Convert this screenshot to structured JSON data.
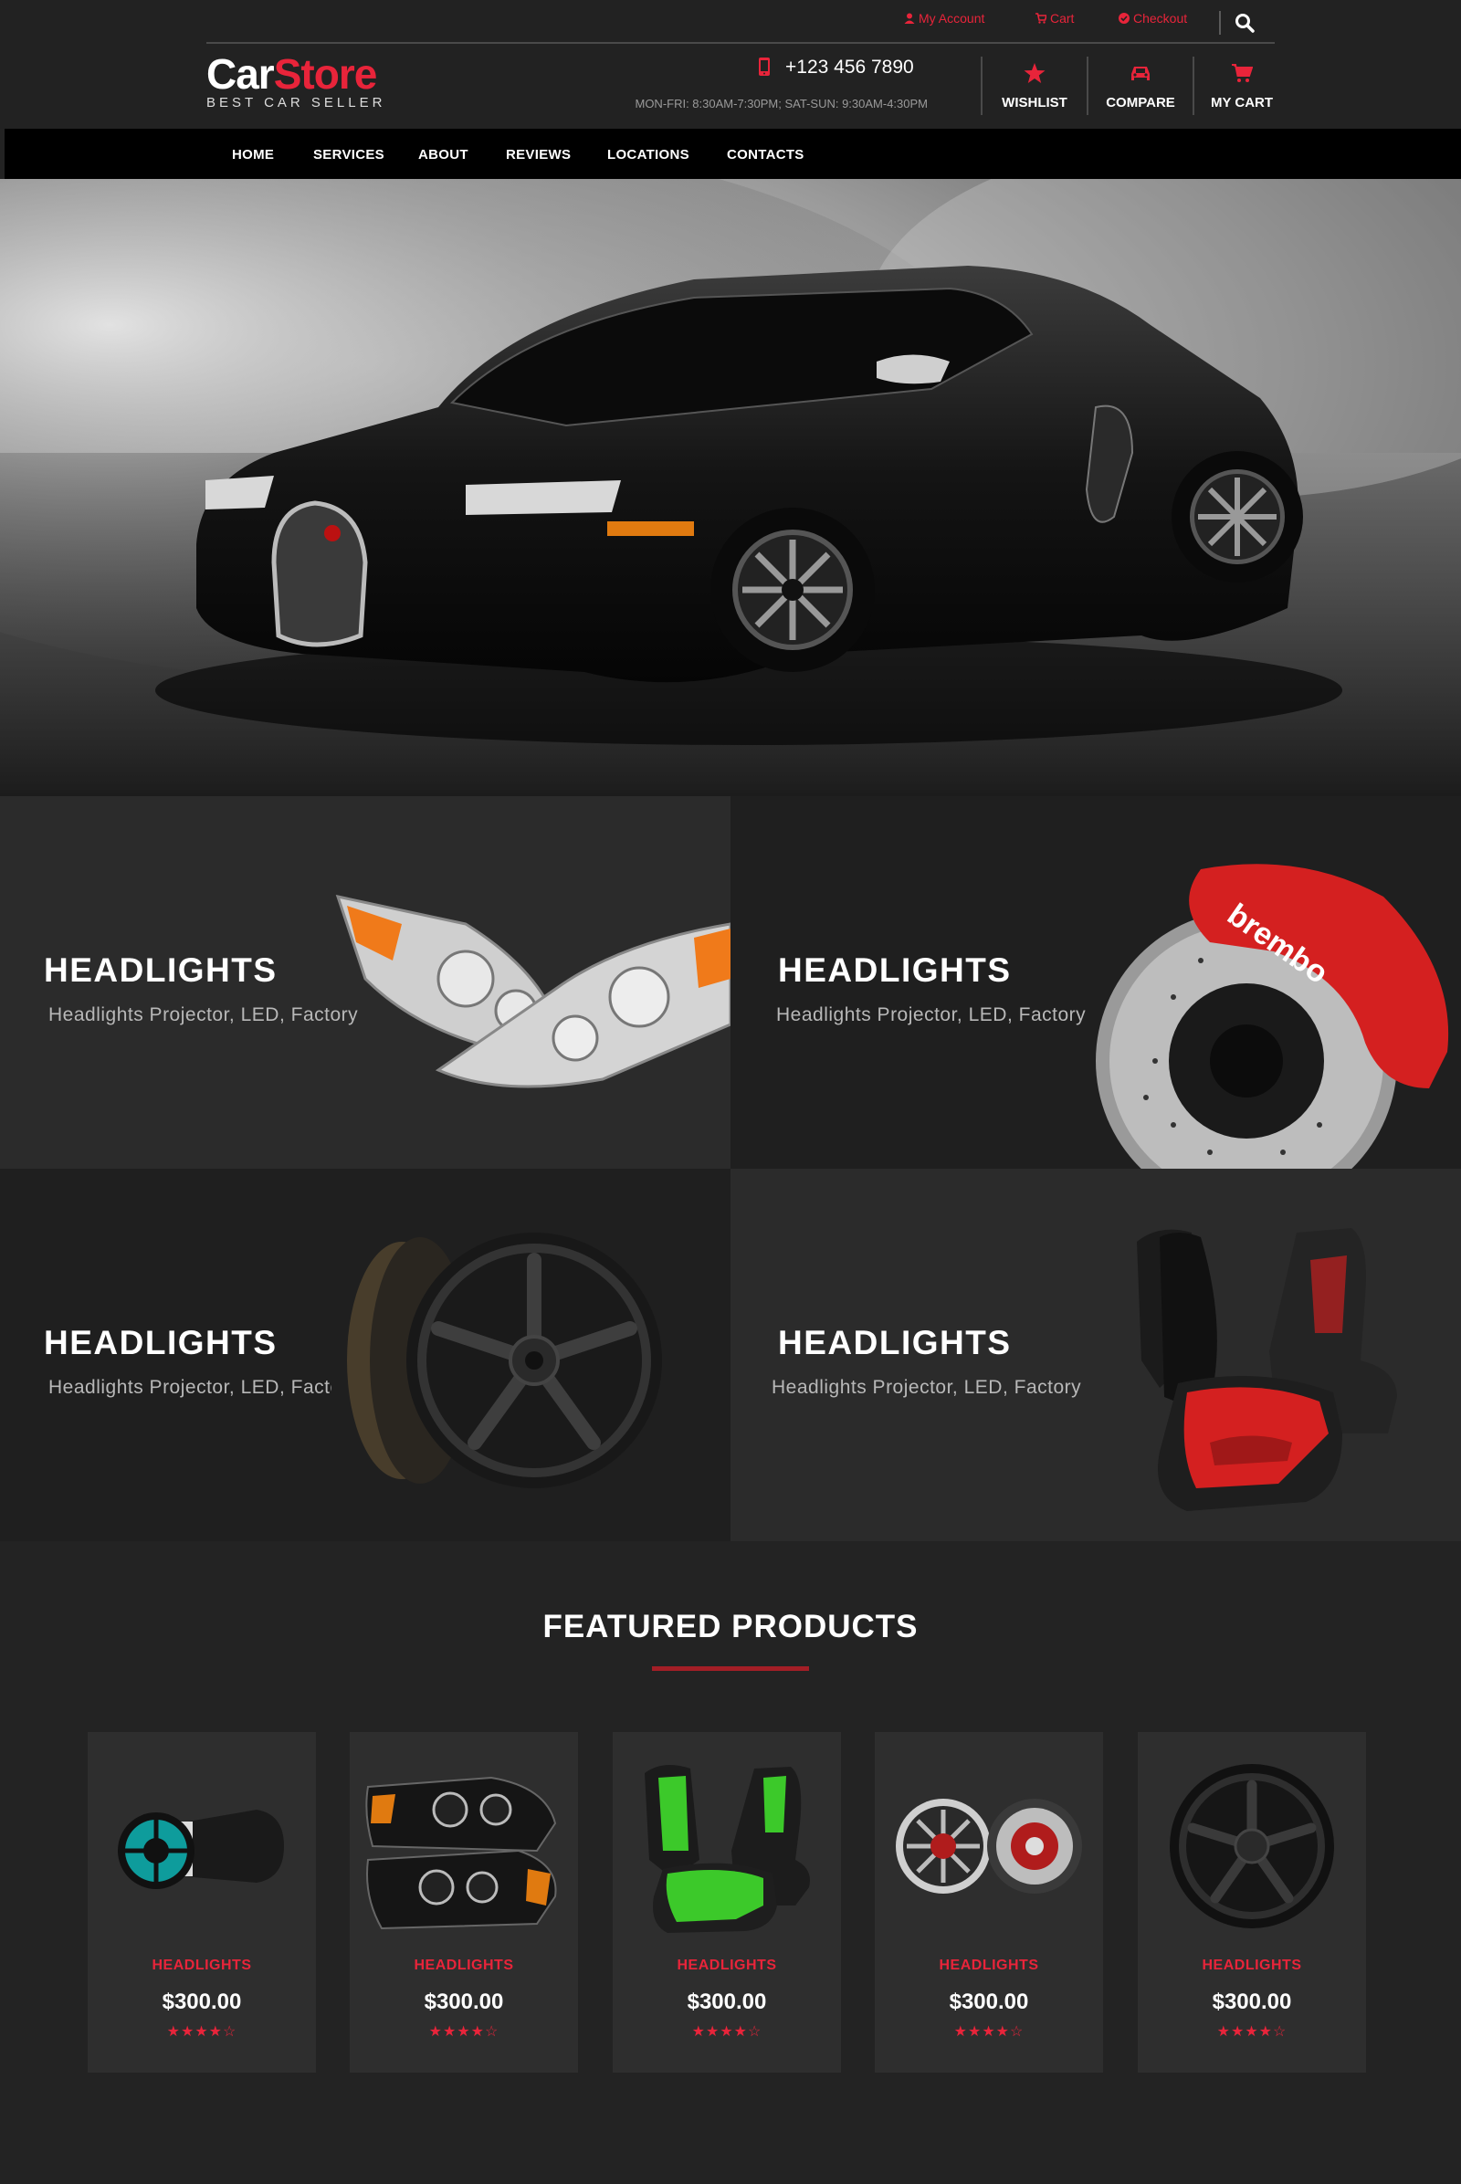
{
  "header": {
    "top_links": [
      {
        "label": "My Account",
        "icon": "user-icon"
      },
      {
        "label": "Cart",
        "icon": "cart-icon"
      },
      {
        "label": "Checkout",
        "icon": "check-circle-icon"
      }
    ],
    "logo": {
      "part1": "Car",
      "part2": "Store",
      "tagline": "BEST CAR SELLER"
    },
    "phone": "+123 456 7890",
    "hours": "MON-FRI: 8:30AM-7:30PM; SAT-SUN: 9:30AM-4:30PM",
    "buttons": [
      {
        "label": "WISHLIST",
        "icon": "star-icon"
      },
      {
        "label": "COMPARE",
        "icon": "car-icon"
      },
      {
        "label": "MY CART",
        "icon": "cart-icon"
      }
    ],
    "accent_color": "#e8243a"
  },
  "nav": {
    "items": [
      "HOME",
      "SERVICES",
      "ABOUT",
      "REVIEWS",
      "LOCATIONS",
      "CONTACTS"
    ]
  },
  "categories": [
    {
      "title": "HEADLIGHTS",
      "subtitle": "Headlights Projector, LED, Factory"
    },
    {
      "title": "HEADLIGHTS",
      "subtitle": "Headlights Projector, LED, Factory"
    },
    {
      "title": "HEADLIGHTS",
      "subtitle": "Headlights Projector, LED, Factory"
    },
    {
      "title": "HEADLIGHTS",
      "subtitle": "Headlights Projector, LED, Factory"
    }
  ],
  "featured": {
    "title": "FEATURED PRODUCTS",
    "products": [
      {
        "name": "HEADLIGHTS",
        "price": "$300.00",
        "rating": 4.5,
        "stars": "★★★★☆"
      },
      {
        "name": "HEADLIGHTS",
        "price": "$300.00",
        "rating": 4.5,
        "stars": "★★★★☆"
      },
      {
        "name": "HEADLIGHTS",
        "price": "$300.00",
        "rating": 4.5,
        "stars": "★★★★☆"
      },
      {
        "name": "HEADLIGHTS",
        "price": "$300.00",
        "rating": 4.5,
        "stars": "★★★★☆"
      },
      {
        "name": "HEADLIGHTS",
        "price": "$300.00",
        "rating": 4.5,
        "stars": "★★★★☆"
      }
    ]
  }
}
